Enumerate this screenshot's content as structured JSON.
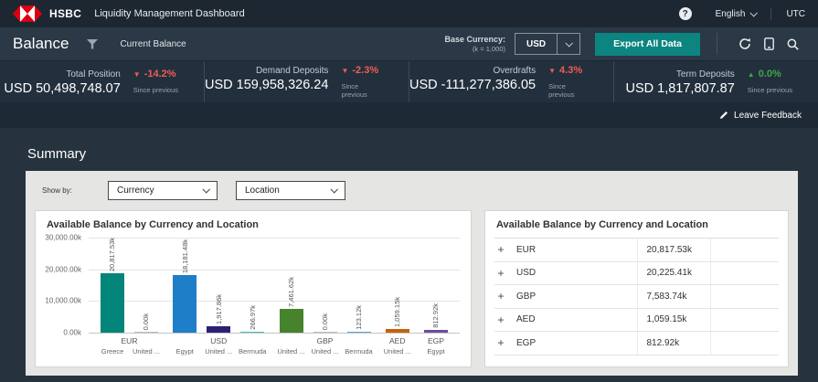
{
  "header": {
    "brand": "HSBC",
    "app_title": "Liquidity Management Dashboard",
    "language": "English",
    "timezone": "UTC",
    "help_label": "?"
  },
  "toolbar": {
    "page_title": "Balance",
    "subtitle": "Current Balance",
    "base_currency_label": "Base Currency:",
    "base_currency_note": "(k = 1,000)",
    "base_currency_value": "USD",
    "export_label": "Export All Data"
  },
  "kpis": [
    {
      "label": "Total Position",
      "value": "USD 50,498,748.07",
      "delta": "-14.2%",
      "direction": "down",
      "note": "Since previous"
    },
    {
      "label": "Demand Deposits",
      "value": "USD 159,958,326.24",
      "delta": "-2.3%",
      "direction": "down",
      "note": "Since previous"
    },
    {
      "label": "Overdrafts",
      "value": "USD -111,277,386.05",
      "delta": "4.3%",
      "direction": "down",
      "note": "Since previous"
    },
    {
      "label": "Term Deposits",
      "value": "USD 1,817,807.87",
      "delta": "0.0%",
      "direction": "up",
      "note": "Since previous"
    }
  ],
  "feedback": {
    "label": "Leave Feedback"
  },
  "summary": {
    "title": "Summary",
    "show_by_label": "Show by:",
    "filters": [
      {
        "value": "Currency"
      },
      {
        "value": "Location"
      }
    ]
  },
  "chart_data": {
    "type": "bar",
    "title": "Available Balance by Currency and Location",
    "ylim": [
      0,
      30000
    ],
    "unit": "k",
    "yticks": [
      "30,000.00k",
      "20,000.00k",
      "10,000.00k",
      "0.00k"
    ],
    "grid": true,
    "groups": [
      {
        "currency": "EUR",
        "bars": [
          {
            "location": "Greece",
            "label": "20,817.53k",
            "value": 20817.53,
            "color": "#038579"
          },
          {
            "location": "United ...",
            "label": "0.00k",
            "value": 0,
            "color": "#b9c0c7"
          }
        ]
      },
      {
        "currency": "USD",
        "bars": [
          {
            "location": "Egypt",
            "label": "18,181.48k",
            "value": 18181.48,
            "color": "#1e7ec8"
          },
          {
            "location": "United ...",
            "label": "1,917.86k",
            "value": 1917.86,
            "color": "#2b2173"
          },
          {
            "location": "Bermuda",
            "label": "266.97k",
            "value": 266.97,
            "color": "#45c1bd"
          }
        ]
      },
      {
        "currency": "GBP",
        "bars": [
          {
            "location": "United ...",
            "label": "7,461.62k",
            "value": 7461.62,
            "color": "#47822c"
          },
          {
            "location": "United ...",
            "label": "0.00k",
            "value": 0,
            "color": "#b9c0c7"
          },
          {
            "location": "Bermuda",
            "label": "123.12k",
            "value": 123.12,
            "color": "#58a7dd"
          }
        ]
      },
      {
        "currency": "AED",
        "bars": [
          {
            "location": "United ...",
            "label": "1,059.15k",
            "value": 1059.15,
            "color": "#c4620e"
          }
        ]
      },
      {
        "currency": "EGP",
        "bars": [
          {
            "location": "Egypt",
            "label": "812.92k",
            "value": 812.92,
            "color": "#6c4ba0"
          }
        ]
      }
    ]
  },
  "table": {
    "title": "Available Balance by Currency and Location",
    "rows": [
      {
        "currency": "EUR",
        "value": "20,817.53k"
      },
      {
        "currency": "USD",
        "value": "20,225.41k"
      },
      {
        "currency": "GBP",
        "value": "7,583.74k"
      },
      {
        "currency": "AED",
        "value": "1,059.15k"
      },
      {
        "currency": "EGP",
        "value": "812.92k"
      }
    ]
  },
  "colors": {
    "brand_red": "#db0011",
    "accent_teal": "#0c8580",
    "delta_down": "#f25c52",
    "delta_up": "#41a546",
    "header_bg": "#1c2732",
    "toolbar_bg": "#2b3845",
    "panel_bg": "#e5e5e3"
  }
}
